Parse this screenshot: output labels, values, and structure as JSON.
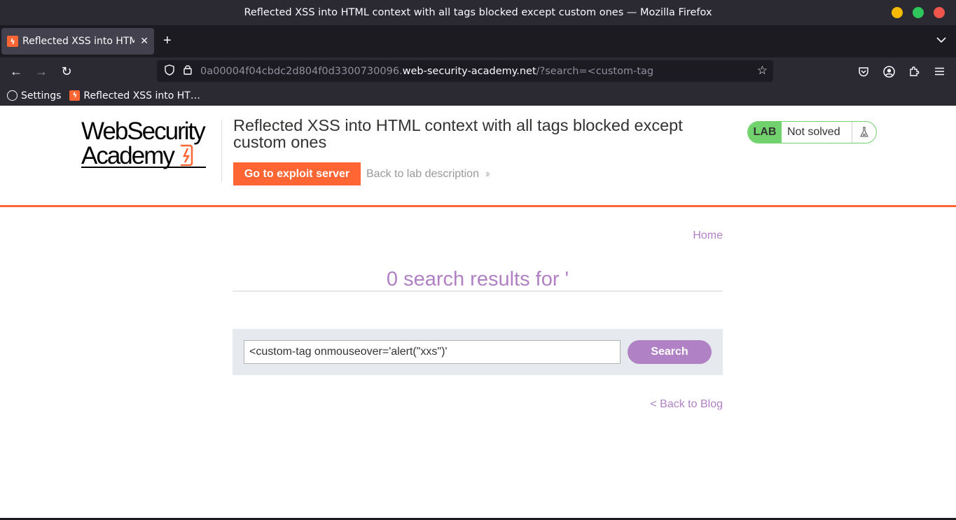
{
  "window": {
    "title": "Reflected XSS into HTML context with all tags blocked except custom ones — Mozilla Firefox",
    "colors": {
      "minimize": "#f6b900",
      "maximize": "#2fc65b",
      "close": "#f0564b"
    }
  },
  "tabs": {
    "active": {
      "title": "Reflected XSS into HTML",
      "favicon": "lightning-icon"
    },
    "new_tab_icon": "+",
    "close_icon": "✕"
  },
  "nav": {
    "back_icon": "←",
    "forward_icon": "→",
    "reload_icon": "↻",
    "url_prefix": "0a00004f04cbdc2d804f0d3300730096.",
    "url_host": "web-security-academy.net",
    "url_path": "/?search=<custom-tag",
    "star_icon": "☆"
  },
  "bookmarks": [
    {
      "label": "Settings",
      "icon": "globe-icon"
    },
    {
      "label": "Reflected XSS into HT…",
      "icon": "lightning-icon"
    }
  ],
  "lab": {
    "logo_line1": "WebSecurity",
    "logo_line2": "Academy",
    "title": "Reflected XSS into HTML context with all tags blocked except custom ones",
    "exploit_button": "Go to exploit server",
    "back_description": "Back to lab description",
    "status_badge": "LAB",
    "status_text": "Not solved",
    "accent_color": "#ff6633",
    "status_color": "#70d16d"
  },
  "content": {
    "home_link": "Home",
    "results_heading": "0 search results for '",
    "search_value": "<custom-tag onmouseover='alert(\"xxs\")'",
    "search_button": "Search",
    "back_to_blog": "< Back to Blog",
    "link_color": "#b081c4"
  }
}
